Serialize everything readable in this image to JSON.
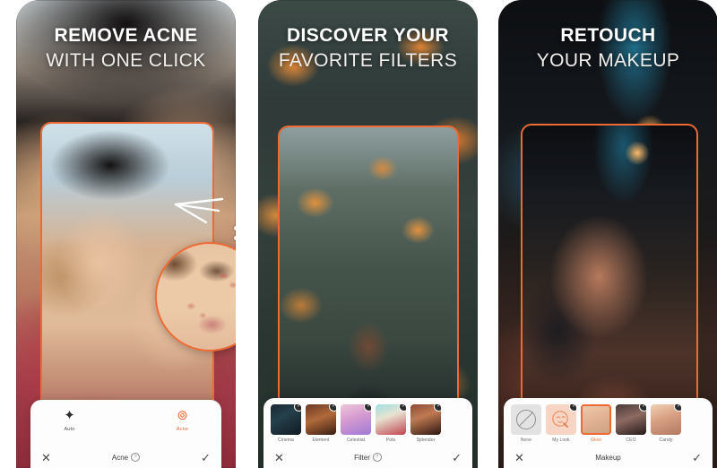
{
  "panels": [
    {
      "id": "remove-acne",
      "headline_bold": "REMOVE ACNE",
      "headline_light": "WITH ONE CLICK",
      "tools": [
        {
          "label": "Auto",
          "icon": "magic-wand-icon",
          "glyph": "✦",
          "active": false
        },
        {
          "label": "Acne",
          "icon": "acne-target-icon",
          "glyph": "⊚",
          "active": true
        }
      ],
      "actionbar": {
        "cancel_icon": "close-icon",
        "cancel_glyph": "✕",
        "title": "Acne",
        "help_glyph": "?",
        "has_help": true,
        "confirm_icon": "check-icon",
        "confirm_glyph": "✓"
      }
    },
    {
      "id": "discover-filters",
      "headline_bold": "DISCOVER YOUR",
      "headline_light": "FAVORITE FILTERS",
      "thumbs": [
        {
          "label": "Cinema",
          "swatch": "t-cinema",
          "badge": "✓",
          "selected": false
        },
        {
          "label": "Element",
          "swatch": "t-element",
          "badge": "✓",
          "selected": false
        },
        {
          "label": "Celestial",
          "swatch": "t-celestial",
          "badge": "✓",
          "selected": false
        },
        {
          "label": "Pola",
          "swatch": "t-pola",
          "badge": "✓",
          "selected": false
        },
        {
          "label": "Splendor",
          "swatch": "t-splendor",
          "badge": "✓",
          "selected": false
        }
      ],
      "actionbar": {
        "cancel_icon": "close-icon",
        "cancel_glyph": "✕",
        "title": "Filter",
        "help_glyph": "?",
        "has_help": true,
        "confirm_icon": "check-icon",
        "confirm_glyph": "✓"
      }
    },
    {
      "id": "retouch-makeup",
      "headline_bold": "RETOUCH",
      "headline_light": "YOUR MAKEUP",
      "thumbs": [
        {
          "label": "None",
          "swatch": "t-none",
          "badge": "",
          "selected": false,
          "icon": "no-makeup-icon"
        },
        {
          "label": "My Look",
          "swatch": "t-mylook",
          "badge": "✓",
          "selected": false,
          "icon": "my-look-icon"
        },
        {
          "label": "Glow",
          "swatch": "t-glow",
          "badge": "",
          "selected": true
        },
        {
          "label": "CEO",
          "swatch": "t-ceo",
          "badge": "✓",
          "selected": false
        },
        {
          "label": "Candy",
          "swatch": "t-candy",
          "badge": "✓",
          "selected": false
        }
      ],
      "actionbar": {
        "cancel_icon": "close-icon",
        "cancel_glyph": "✕",
        "title": "Makeup",
        "help_glyph": "",
        "has_help": false,
        "confirm_icon": "check-icon",
        "confirm_glyph": "✓"
      }
    }
  ],
  "colors": {
    "accent": "#ef6a33",
    "panel_surface": "#fdfdfd",
    "headline_bold": "#ffffff",
    "headline_light": "#f0eeec",
    "badge_bg": "#2b2b2b"
  }
}
